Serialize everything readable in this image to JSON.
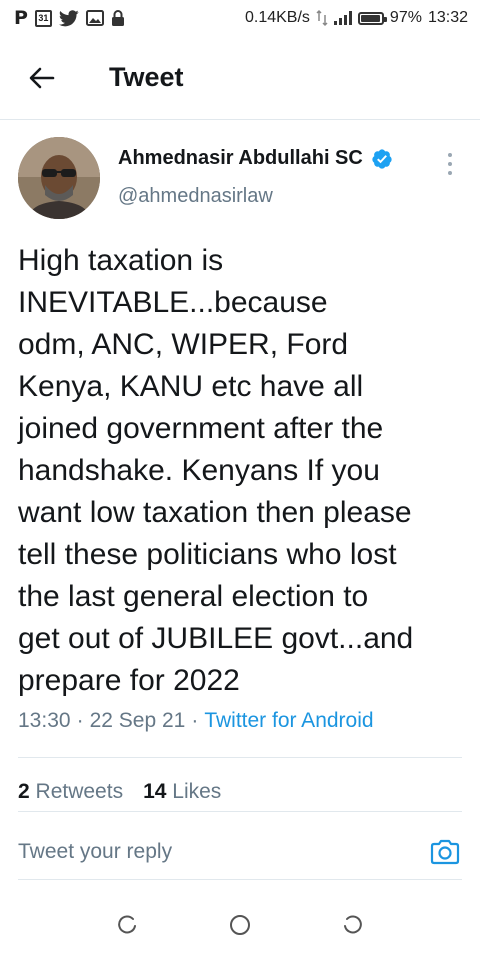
{
  "status_bar": {
    "network_speed": "0.14KB/s",
    "battery_percent": "97%",
    "time": "13:32",
    "calendar_day": "31",
    "icons": [
      "p-app-icon",
      "calendar-icon",
      "twitter-bird-icon",
      "gallery-icon",
      "lock-icon",
      "data-arrows-icon",
      "signal-icon",
      "battery-icon"
    ],
    "battery_level": 0.97
  },
  "header": {
    "title": "Tweet"
  },
  "tweet": {
    "author_name": "Ahmednasir Abdullahi SC",
    "handle": "@ahmednasirlaw",
    "verified": true,
    "text": "High taxation is\nINEVITABLE...because\nodm, ANC, WIPER, Ford\nKenya, KANU etc have all\njoined government after the\nhandshake. Kenyans If you\nwant low taxation then please\ntell these politicians who lost\nthe last general election to\nget out of JUBILEE govt...and\nprepare for 2022",
    "time": "13:30",
    "date": "22 Sep 21",
    "separator": "·",
    "source": "Twitter for Android",
    "retweets_count": "2",
    "retweets_label": "Retweets",
    "likes_count": "14",
    "likes_label": "Likes"
  },
  "reply": {
    "placeholder": "Tweet your reply"
  },
  "colors": {
    "twitter_blue": "#1b95e0",
    "text": "#14171a",
    "secondary": "#657786",
    "divider": "#e1e8ed"
  }
}
